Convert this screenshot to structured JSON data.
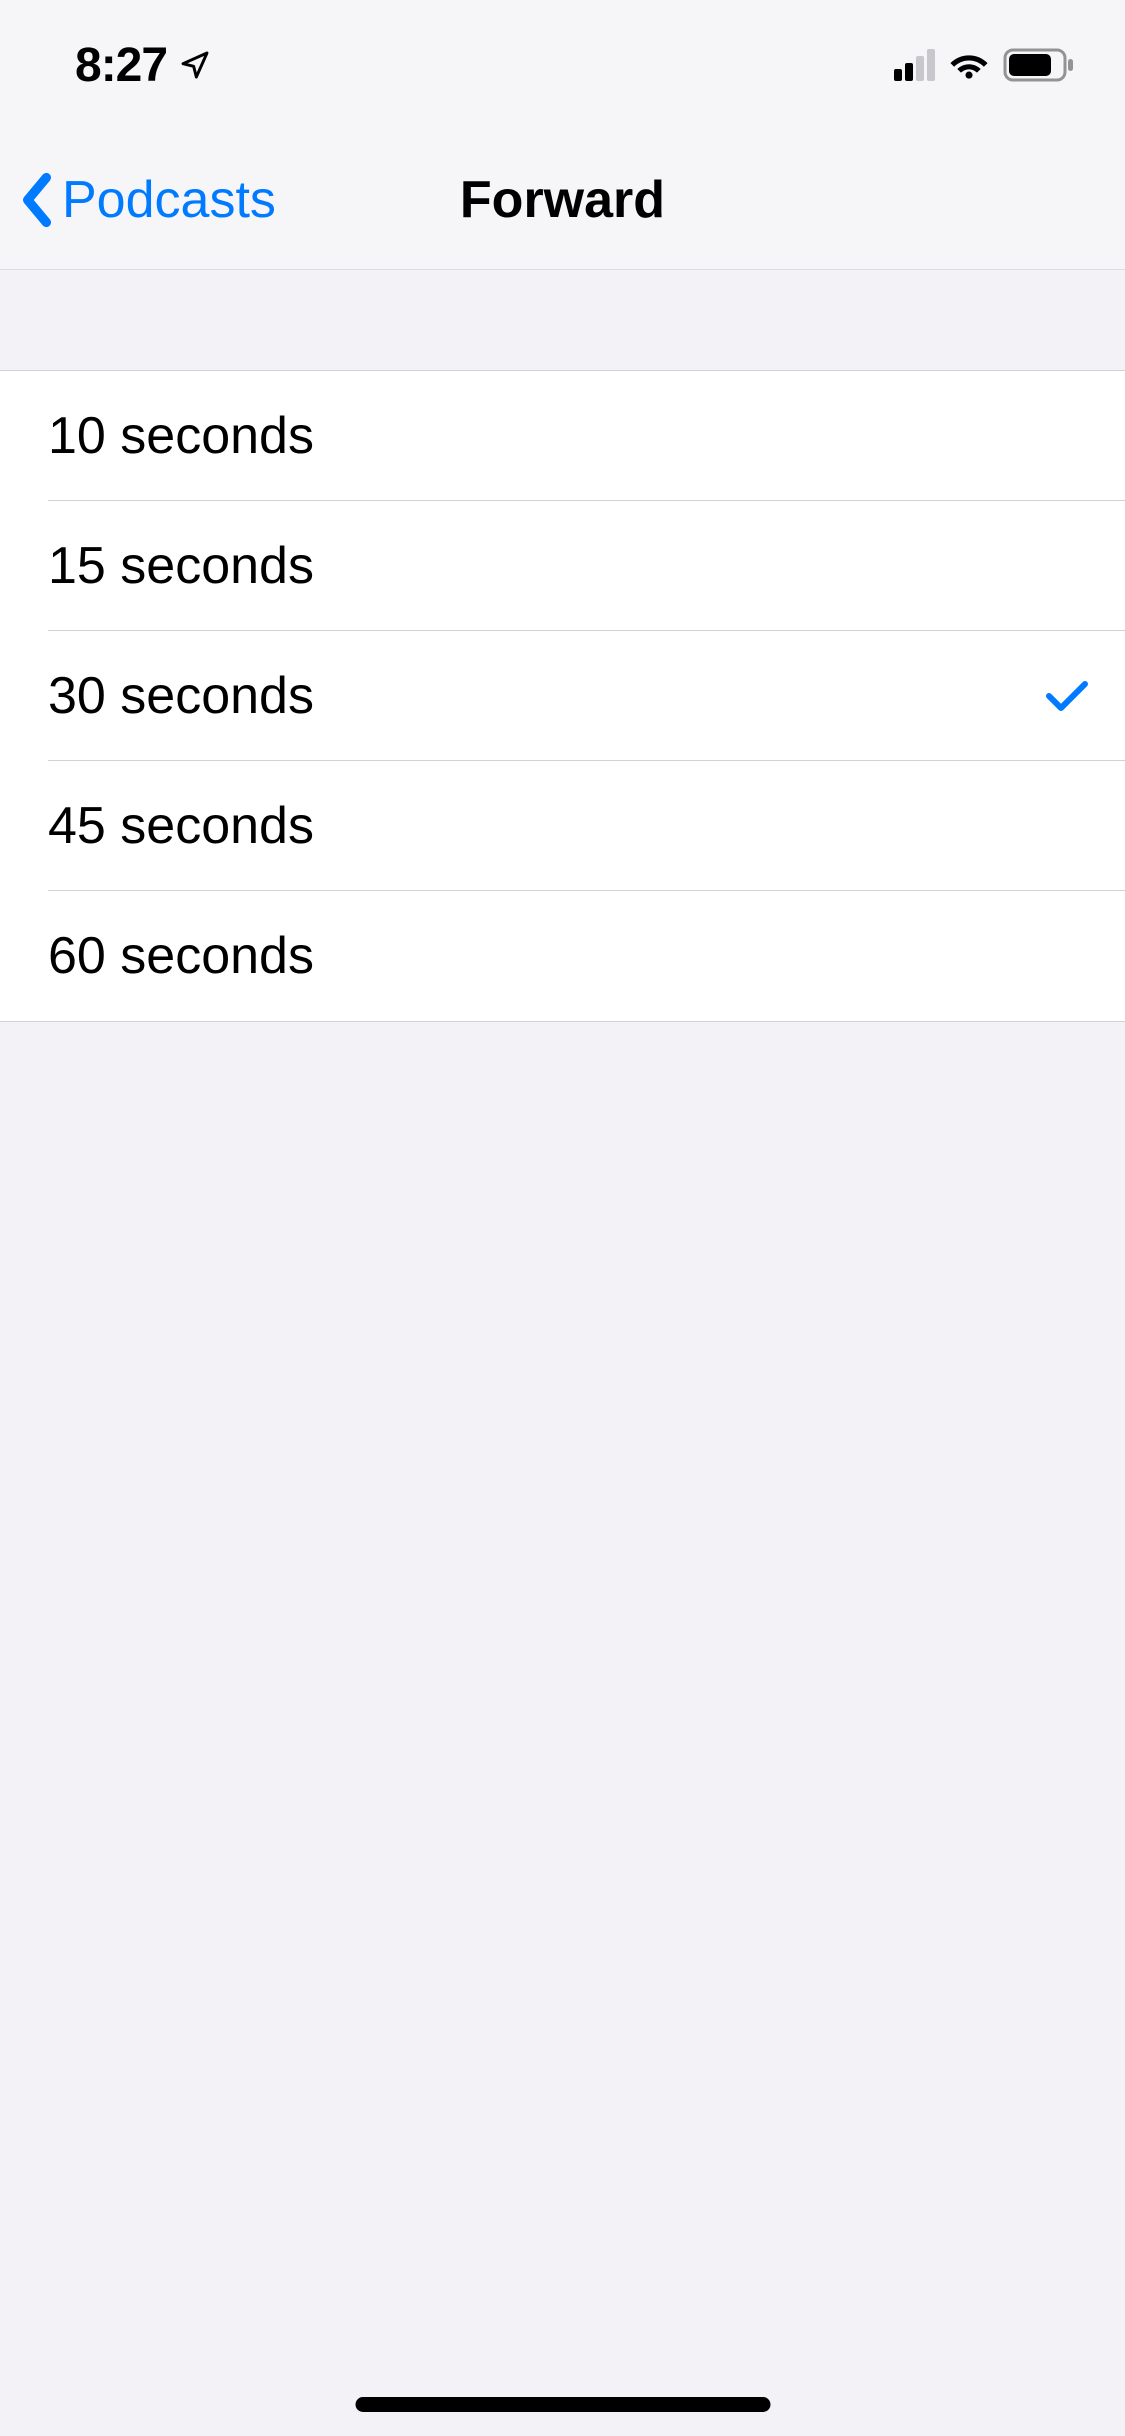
{
  "statusBar": {
    "time": "8:27"
  },
  "nav": {
    "backLabel": "Podcasts",
    "title": "Forward"
  },
  "options": [
    {
      "label": "10 seconds",
      "selected": false
    },
    {
      "label": "15 seconds",
      "selected": false
    },
    {
      "label": "30 seconds",
      "selected": true
    },
    {
      "label": "45 seconds",
      "selected": false
    },
    {
      "label": "60 seconds",
      "selected": false
    }
  ],
  "colors": {
    "accent": "#007aff",
    "background": "#f2f2f7",
    "listBackground": "#ffffff",
    "separator": "#d1d1d6"
  }
}
